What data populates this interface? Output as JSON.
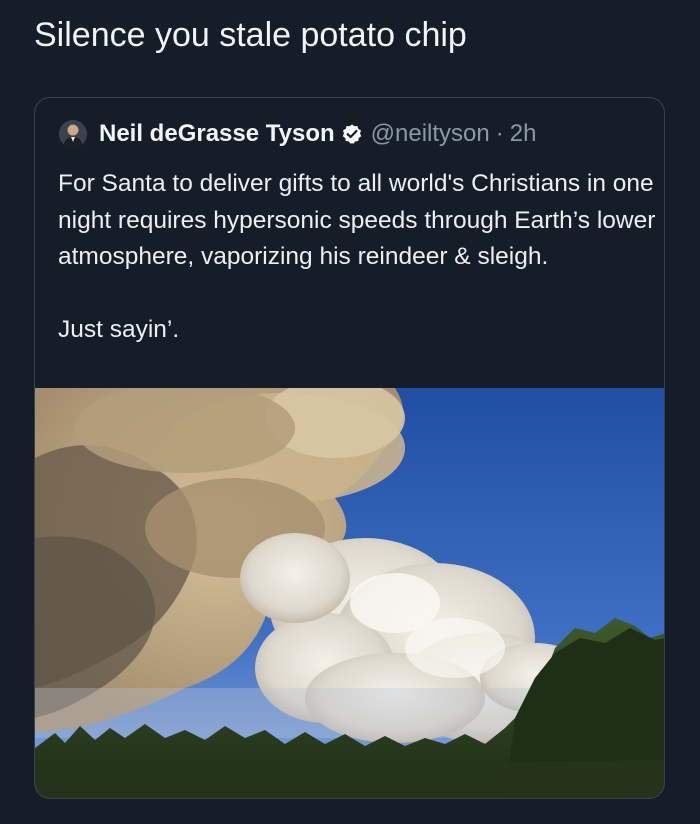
{
  "post": {
    "text": "Silence you stale potato chip"
  },
  "quoted_tweet": {
    "author_name": "Neil deGrasse Tyson",
    "handle": "@neiltyson",
    "separator": "·",
    "time": "2h",
    "verified": true,
    "body_line_1": "For Santa to deliver gifts to all world's Christians in one night requires hypersonic speeds through Earth’s lower atmosphere, vaporizing his reindeer & sleigh.",
    "body_line_2": "Just sayin’.",
    "media": {
      "type": "photo",
      "icon": "smoke-plume-photo"
    }
  },
  "colors": {
    "background": "#151d28",
    "card_border": "#38444d",
    "secondary_text": "#8b98a5",
    "verified_badge": "#ffffff"
  }
}
